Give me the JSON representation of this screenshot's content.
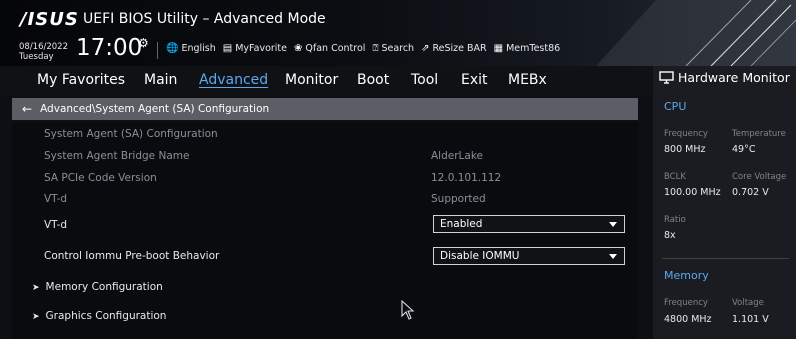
{
  "header": {
    "logo": "/ISUS",
    "title": "UEFI BIOS Utility – Advanced Mode",
    "date": "08/16/2022",
    "day": "Tuesday",
    "time": "17:00",
    "tools": [
      {
        "icon": "globe-icon",
        "label": "English"
      },
      {
        "icon": "myfavorite-icon",
        "label": "MyFavorite"
      },
      {
        "icon": "fan-icon",
        "label": "Qfan Control"
      },
      {
        "icon": "help-icon",
        "label": "Search"
      },
      {
        "icon": "resize-bar-icon",
        "label": "ReSize BAR"
      },
      {
        "icon": "memtest-icon",
        "label": "MemTest86"
      }
    ]
  },
  "nav": {
    "tabs": [
      "My Favorites",
      "Main",
      "Advanced",
      "Monitor",
      "Boot",
      "Tool",
      "Exit",
      "MEBx"
    ],
    "active": "Advanced"
  },
  "breadcrumb": "Advanced\\System Agent (SA) Configuration",
  "content": {
    "section_title": "System Agent (SA) Configuration",
    "bridge_label": "System Agent Bridge Name",
    "bridge_value": "AlderLake",
    "pcie_label": "SA PCIe Code Version",
    "pcie_value": "12.0.101.112",
    "vtd_info_label": "VT-d",
    "vtd_info_value": "Supported",
    "vtd_label": "VT-d",
    "vtd_value": "Enabled",
    "iommu_label": "Control Iommu Pre-boot Behavior",
    "iommu_value": "Disable IOMMU",
    "submenus": [
      "Memory Configuration",
      "Graphics Configuration"
    ]
  },
  "hw_monitor": {
    "title": "Hardware Monitor",
    "cpu": {
      "heading": "CPU",
      "frequency_label": "Frequency",
      "frequency_value": "800 MHz",
      "temperature_label": "Temperature",
      "temperature_value": "49°C",
      "bclk_label": "BCLK",
      "bclk_value": "100.00 MHz",
      "core_voltage_label": "Core Voltage",
      "core_voltage_value": "0.702 V",
      "ratio_label": "Ratio",
      "ratio_value": "8x"
    },
    "memory": {
      "heading": "Memory",
      "frequency_label": "Frequency",
      "frequency_value": "4800 MHz",
      "voltage_label": "Voltage",
      "voltage_value": "1.101 V"
    }
  },
  "colors": {
    "accent": "#5ba8f0",
    "breadcrumb_bg": "#5b5e64",
    "panel_bg": "#1a1c21"
  }
}
